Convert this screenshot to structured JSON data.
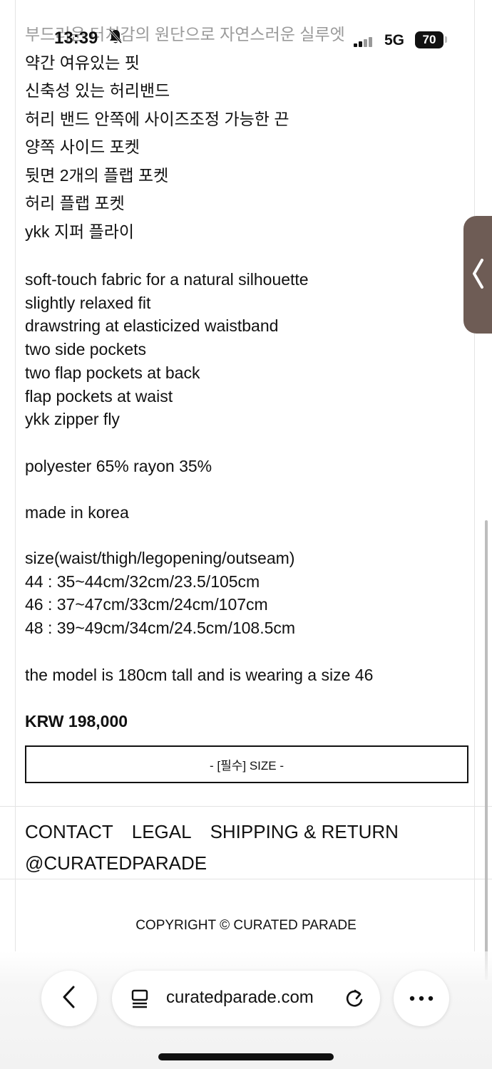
{
  "status_bar": {
    "time": "13:39",
    "network": "5G",
    "battery": "70"
  },
  "description_kr": [
    "부드러운 터치감의 원단으로 자연스러운 실루엣",
    "약간 여유있는 핏",
    "신축성 있는 허리밴드",
    "허리 밴드 안쪽에 사이즈조정 가능한 끈",
    "양쪽 사이드 포켓",
    "뒷면 2개의 플랩 포켓",
    "허리 플랩 포켓",
    "ykk 지퍼 플라이"
  ],
  "description_en": [
    "soft-touch fabric for a natural silhouette",
    "slightly relaxed fit",
    "drawstring at elasticized waistband",
    "two side pockets",
    "two flap pockets at back",
    "flap pockets at waist",
    "ykk zipper fly"
  ],
  "material": "polyester 65% rayon 35%",
  "origin": "made in korea",
  "size_info": [
    "size(waist/thigh/legopening/outseam)",
    "44 : 35~44cm/32cm/23.5/105cm",
    "46 : 37~47cm/33cm/24cm/107cm",
    "48 : 39~49cm/34cm/24.5cm/108.5cm"
  ],
  "model_note": "the model is 180cm tall and is wearing a size 46",
  "price": "KRW 198,000",
  "size_select": {
    "label": "- [필수] SIZE -"
  },
  "footer": {
    "links": [
      "CONTACT",
      "LEGAL",
      "SHIPPING & RETURN"
    ],
    "instagram": "@CURATEDPARADE",
    "copyright": "COPYRIGHT © CURATED PARADE"
  },
  "browser": {
    "url": "curatedparade.com",
    "icons": [
      "back-icon",
      "reader-icon",
      "reload-icon",
      "more-icon"
    ]
  },
  "side_tab": {
    "icon": "chevron-left-icon"
  }
}
